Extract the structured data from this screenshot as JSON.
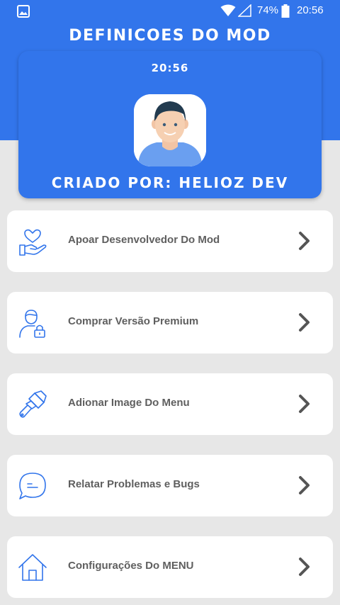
{
  "status_bar": {
    "battery": "74%",
    "time": "20:56",
    "icons": [
      "image-notification-icon",
      "wifi-icon",
      "signal-icon",
      "battery-icon"
    ]
  },
  "header": {
    "title": "DEFINICOES DO MOD"
  },
  "profile": {
    "time": "20:56",
    "creator": "CRIADO POR: HELIOZ DEV"
  },
  "menu": [
    {
      "label": "Apoar Desenvolvedor Do Mod",
      "icon": "heart-hand-icon"
    },
    {
      "label": "Comprar Versão Premium",
      "icon": "user-lock-icon"
    },
    {
      "label": "Adionar Image Do Menu",
      "icon": "paint-brush-icon"
    },
    {
      "label": "Relatar Problemas e Bugs",
      "icon": "chat-bubble-icon"
    },
    {
      "label": "Configurações Do MENU",
      "icon": "home-icon"
    }
  ],
  "colors": {
    "primary": "#3275eb",
    "background": "#e7e7e7",
    "card": "#ffffff",
    "label": "#5f5f5f",
    "icon": "#3275eb"
  }
}
